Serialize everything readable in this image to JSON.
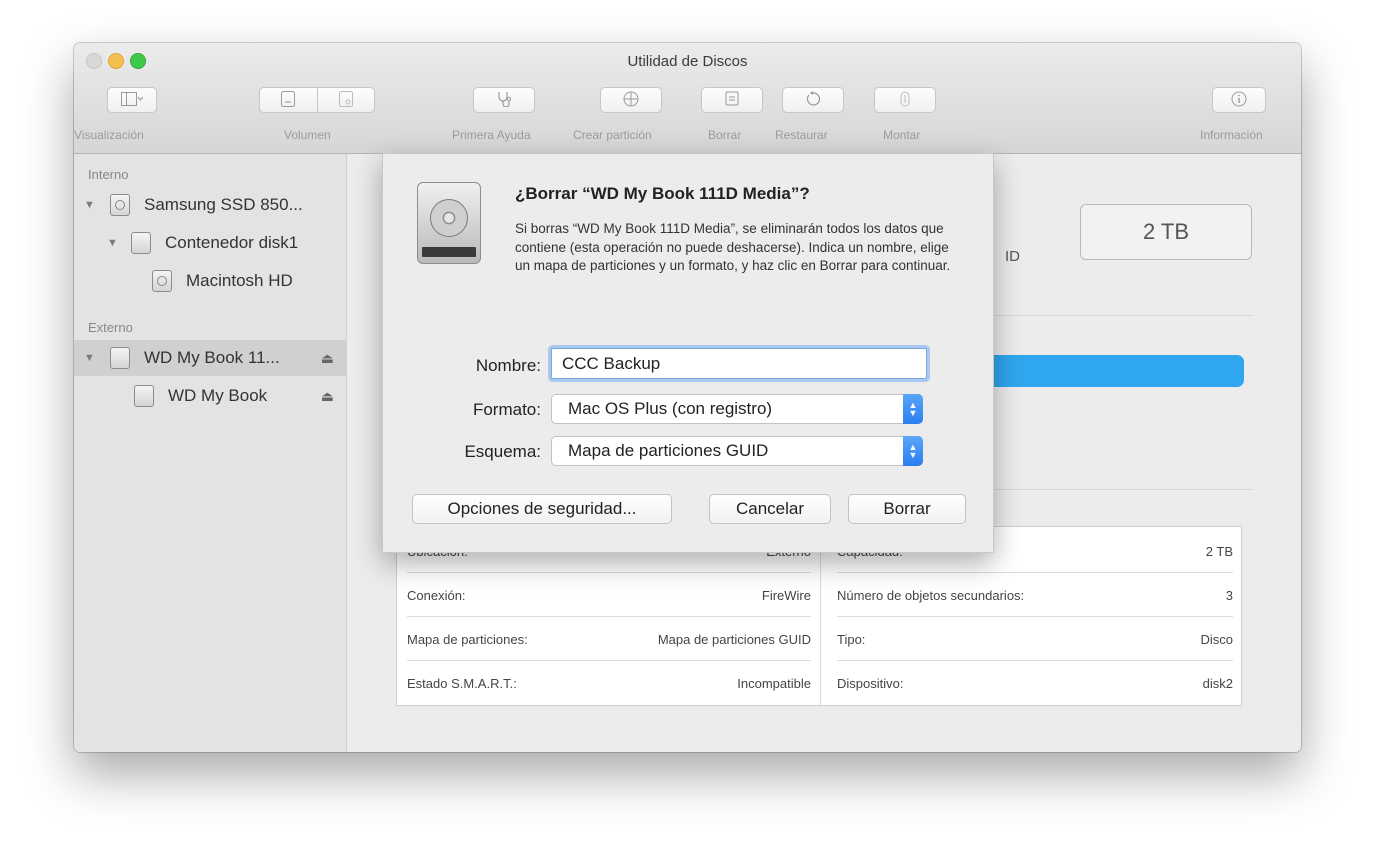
{
  "window": {
    "title": "Utilidad de Discos"
  },
  "toolbar": {
    "visualizacion_label": "Visualización",
    "volumen_label": "Volumen",
    "primera_ayuda_label": "Primera Ayuda",
    "crear_particion_label": "Crear partición",
    "borrar_label": "Borrar",
    "restaurar_label": "Restaurar",
    "montar_label": "Montar",
    "informacion_label": "Información"
  },
  "sidebar": {
    "interno_label": "Interno",
    "externo_label": "Externo",
    "items": [
      {
        "label": "Samsung SSD 850..."
      },
      {
        "label": "Contenedor disk1"
      },
      {
        "label": "Macintosh HD"
      },
      {
        "label": "WD My Book 11..."
      },
      {
        "label": "WD My Book"
      }
    ]
  },
  "main": {
    "capacity": "2 TB",
    "partial_text": "ID",
    "info": {
      "left": [
        {
          "label": "Ubicación:",
          "value": "Externo"
        },
        {
          "label": "Conexión:",
          "value": "FireWire"
        },
        {
          "label": "Mapa de particiones:",
          "value": "Mapa de particiones GUID"
        },
        {
          "label": "Estado S.M.A.R.T.:",
          "value": "Incompatible"
        }
      ],
      "right": [
        {
          "label": "Capacidad:",
          "value": "2 TB"
        },
        {
          "label": "Número de objetos secundarios:",
          "value": "3"
        },
        {
          "label": "Tipo:",
          "value": "Disco"
        },
        {
          "label": "Dispositivo:",
          "value": "disk2"
        }
      ]
    }
  },
  "dialog": {
    "title": "¿Borrar “WD My Book 111D Media”?",
    "message": "Si borras “WD My Book 111D Media”, se eliminarán todos los datos que contiene (esta operación no puede deshacerse). Indica un nombre, elige un mapa de particiones y un formato, y haz clic en Borrar para continuar.",
    "nombre_label": "Nombre:",
    "nombre_value": "CCC Backup",
    "formato_label": "Formato:",
    "formato_value": "Mac OS Plus (con registro)",
    "esquema_label": "Esquema:",
    "esquema_value": "Mapa de particiones GUID",
    "opciones_button": "Opciones de seguridad...",
    "cancel_button": "Cancelar",
    "erase_button": "Borrar"
  }
}
